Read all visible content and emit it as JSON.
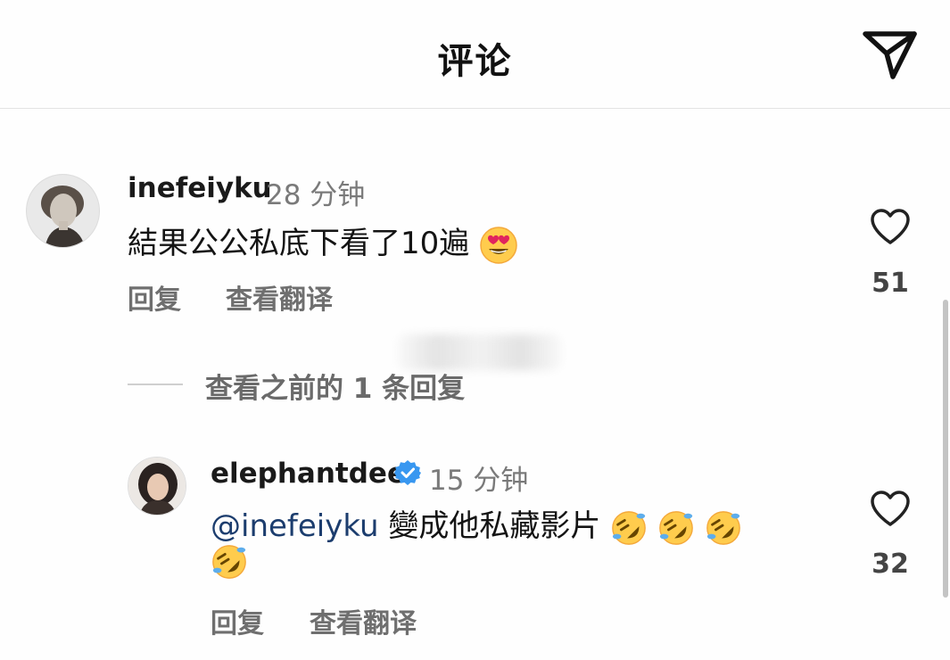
{
  "header": {
    "title": "评论",
    "share_icon": "paper-plane-icon"
  },
  "comments": [
    {
      "username": "inefeiyku",
      "time": "28 分钟",
      "text": "結果公公私底下看了10遍",
      "emoji": "heart-eyes-face-icon",
      "reply_label": "回复",
      "translate_label": "查看翻译",
      "like_count": "51"
    }
  ],
  "view_replies_label": "查看之前的 1 条回复",
  "replies": [
    {
      "username": "elephantdee",
      "verified": true,
      "time": "15 分钟",
      "mention": "@inefeiyku",
      "text": "變成他私藏影片",
      "emoji": "rolling-on-floor-laughing-face-icon",
      "reply_label": "回复",
      "translate_label": "查看翻译",
      "like_count": "32"
    }
  ],
  "colors": {
    "verified_blue": "#3897f0",
    "mention_blue": "#1c3d6e",
    "secondary_text": "#6f6f6f"
  }
}
